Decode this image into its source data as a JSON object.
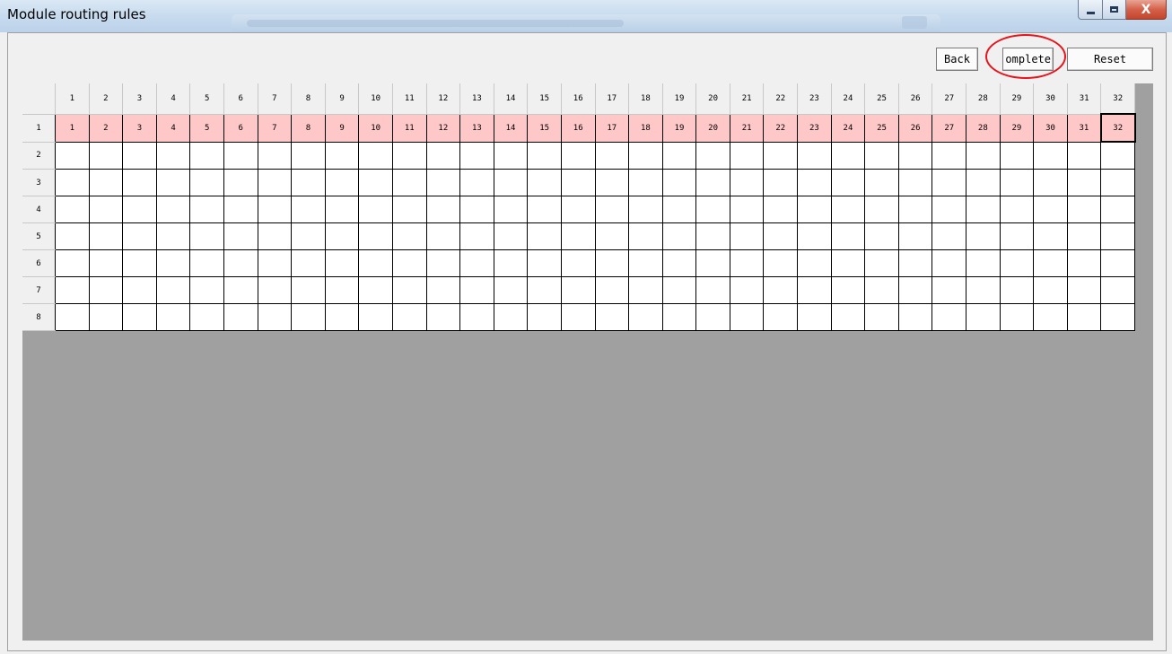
{
  "window": {
    "title": "Module routing rules",
    "close_glyph": "X"
  },
  "toolbar": {
    "back_label": "Back",
    "complete_label": "omplete",
    "reset_label": "Reset"
  },
  "grid": {
    "column_headers": [
      "1",
      "2",
      "3",
      "4",
      "5",
      "6",
      "7",
      "8",
      "9",
      "10",
      "11",
      "12",
      "13",
      "14",
      "15",
      "16",
      "17",
      "18",
      "19",
      "20",
      "21",
      "22",
      "23",
      "24",
      "25",
      "26",
      "27",
      "28",
      "29",
      "30",
      "31",
      "32"
    ],
    "row_headers": [
      "1",
      "2",
      "3",
      "4",
      "5",
      "6",
      "7",
      "8"
    ],
    "rows": [
      [
        "1",
        "2",
        "3",
        "4",
        "5",
        "6",
        "7",
        "8",
        "9",
        "10",
        "11",
        "12",
        "13",
        "14",
        "15",
        "16",
        "17",
        "18",
        "19",
        "20",
        "21",
        "22",
        "23",
        "24",
        "25",
        "26",
        "27",
        "28",
        "29",
        "30",
        "31",
        "32"
      ],
      [
        "",
        "",
        "",
        "",
        "",
        "",
        "",
        "",
        "",
        "",
        "",
        "",
        "",
        "",
        "",
        "",
        "",
        "",
        "",
        "",
        "",
        "",
        "",
        "",
        "",
        "",
        "",
        "",
        "",
        "",
        "",
        ""
      ],
      [
        "",
        "",
        "",
        "",
        "",
        "",
        "",
        "",
        "",
        "",
        "",
        "",
        "",
        "",
        "",
        "",
        "",
        "",
        "",
        "",
        "",
        "",
        "",
        "",
        "",
        "",
        "",
        "",
        "",
        "",
        "",
        ""
      ],
      [
        "",
        "",
        "",
        "",
        "",
        "",
        "",
        "",
        "",
        "",
        "",
        "",
        "",
        "",
        "",
        "",
        "",
        "",
        "",
        "",
        "",
        "",
        "",
        "",
        "",
        "",
        "",
        "",
        "",
        "",
        "",
        ""
      ],
      [
        "",
        "",
        "",
        "",
        "",
        "",
        "",
        "",
        "",
        "",
        "",
        "",
        "",
        "",
        "",
        "",
        "",
        "",
        "",
        "",
        "",
        "",
        "",
        "",
        "",
        "",
        "",
        "",
        "",
        "",
        "",
        ""
      ],
      [
        "",
        "",
        "",
        "",
        "",
        "",
        "",
        "",
        "",
        "",
        "",
        "",
        "",
        "",
        "",
        "",
        "",
        "",
        "",
        "",
        "",
        "",
        "",
        "",
        "",
        "",
        "",
        "",
        "",
        "",
        "",
        ""
      ],
      [
        "",
        "",
        "",
        "",
        "",
        "",
        "",
        "",
        "",
        "",
        "",
        "",
        "",
        "",
        "",
        "",
        "",
        "",
        "",
        "",
        "",
        "",
        "",
        "",
        "",
        "",
        "",
        "",
        "",
        "",
        "",
        ""
      ],
      [
        "",
        "",
        "",
        "",
        "",
        "",
        "",
        "",
        "",
        "",
        "",
        "",
        "",
        "",
        "",
        "",
        "",
        "",
        "",
        "",
        "",
        "",
        "",
        "",
        "",
        "",
        "",
        "",
        "",
        "",
        "",
        ""
      ]
    ],
    "mapped_row": 0,
    "current_cell": {
      "row": 0,
      "col": 31
    }
  },
  "colors": {
    "mapped_cell": "#ffc8c8",
    "empty_area": "#a0a0a0",
    "highlight_circle": "#e8141c"
  }
}
